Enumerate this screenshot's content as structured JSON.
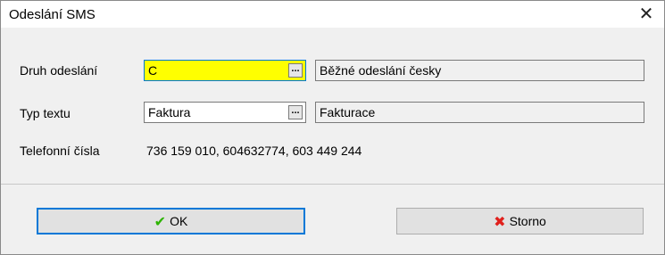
{
  "window": {
    "title": "Odeslání SMS",
    "close_label": "✕"
  },
  "form": {
    "druh": {
      "label": "Druh odeslání",
      "value": "C",
      "button": "...",
      "description": "Běžné odeslání česky"
    },
    "typ": {
      "label": "Typ textu",
      "value": "Faktura",
      "button": "...",
      "description": "Fakturace"
    },
    "telefon": {
      "label": "Telefonní čísla",
      "value": "736 159 010, 604632774, 603 449 244"
    }
  },
  "buttons": {
    "ok": {
      "icon": "✔",
      "label": "OK",
      "icon_color": "#2db400"
    },
    "storno": {
      "icon": "✖",
      "label": "Storno",
      "icon_color": "#e0201c"
    }
  }
}
